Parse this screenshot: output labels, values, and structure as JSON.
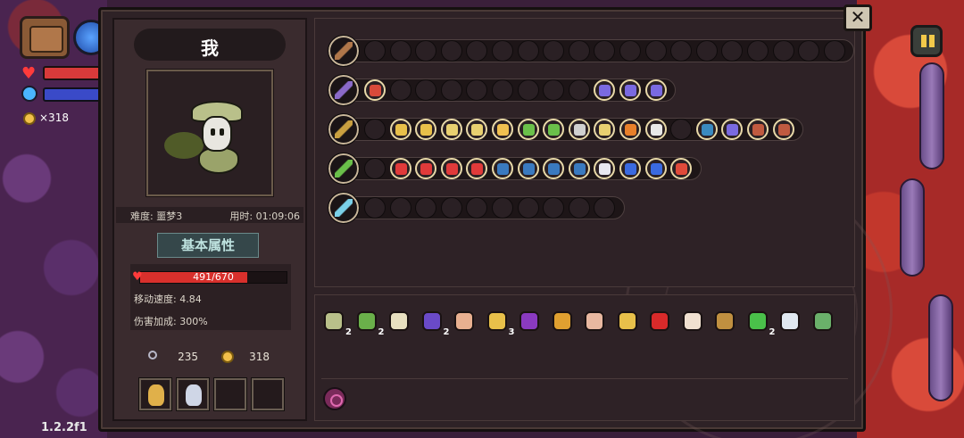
{
  "hud": {
    "coins": "×318",
    "version": "1.2.2f1",
    "close_label": "✕"
  },
  "player": {
    "name": "我",
    "difficulty": "难度: 噩梦3",
    "time": "用时: 01:09:06"
  },
  "attributes": {
    "title": "基本属性",
    "hp_text": "491/670",
    "hp_fraction": 0.733,
    "move_speed": "移动速度: 4.84",
    "damage_bonus": "伤害加成: 300%"
  },
  "resources": {
    "keys": "235",
    "gold": "318"
  },
  "consumable_slots": [
    {
      "icon": "golden-lantern-icon",
      "color": "#e0b04a"
    },
    {
      "icon": "potion-bottle-icon",
      "color": "#cfd6e6"
    },
    {
      "icon": "empty",
      "color": ""
    },
    {
      "icon": "empty",
      "color": ""
    }
  ],
  "weapon_rows": [
    {
      "weapon_icon": "chest-icon",
      "weapon_color": "#b0774a",
      "slots": 19,
      "items": []
    },
    {
      "weapon_icon": "dark-spear-icon",
      "weapon_color": "#8a6ac8",
      "slots": 12,
      "items": [
        {
          "index": 0,
          "icon": "target-icon",
          "color": "#d84a3a"
        },
        {
          "index": 9,
          "icon": "blade-icon",
          "color": "#7a6ae0"
        },
        {
          "index": 10,
          "icon": "blade-icon",
          "color": "#7a6ae0"
        },
        {
          "index": 11,
          "icon": "blade-icon",
          "color": "#7a6ae0"
        }
      ]
    },
    {
      "weapon_icon": "golden-staff-icon",
      "weapon_color": "#c9a040",
      "slots": 17,
      "items": [
        {
          "index": 1,
          "icon": "arrow-icon",
          "color": "#e8c04a"
        },
        {
          "index": 2,
          "icon": "arrow-icon",
          "color": "#e8c04a"
        },
        {
          "index": 3,
          "icon": "scroll-icon",
          "color": "#e8d070"
        },
        {
          "index": 4,
          "icon": "scroll-icon",
          "color": "#e8d070"
        },
        {
          "index": 5,
          "icon": "upgrade-icon",
          "color": "#f0c050"
        },
        {
          "index": 6,
          "icon": "leaf-icon",
          "color": "#6ac04a"
        },
        {
          "index": 7,
          "icon": "leaf-icon",
          "color": "#6ac04a"
        },
        {
          "index": 8,
          "icon": "eye-icon",
          "color": "#d0d0d0"
        },
        {
          "index": 9,
          "icon": "scroll-icon",
          "color": "#e8d070"
        },
        {
          "index": 10,
          "icon": "flame-icon",
          "color": "#e8802a"
        },
        {
          "index": 11,
          "icon": "mouse-icon",
          "color": "#e8e8e8"
        },
        {
          "index": 13,
          "icon": "bow-icon",
          "color": "#3a8ac0"
        },
        {
          "index": 14,
          "icon": "blade-icon",
          "color": "#7a6ae0"
        },
        {
          "index": 15,
          "icon": "heart-organ-icon",
          "color": "#c05a40"
        },
        {
          "index": 16,
          "icon": "heart-organ-icon",
          "color": "#c05a40"
        }
      ]
    },
    {
      "weapon_icon": "green-staff-icon",
      "weapon_color": "#6ac04a",
      "slots": 13,
      "items": [
        {
          "index": 1,
          "icon": "berries-icon",
          "color": "#e03a3a"
        },
        {
          "index": 2,
          "icon": "berries-icon",
          "color": "#e03a3a"
        },
        {
          "index": 3,
          "icon": "berries-icon",
          "color": "#e03a3a"
        },
        {
          "index": 4,
          "icon": "berries-icon",
          "color": "#e03a3a"
        },
        {
          "index": 5,
          "icon": "dagger-icon",
          "color": "#3a7ac0"
        },
        {
          "index": 6,
          "icon": "dagger-icon",
          "color": "#3a7ac0"
        },
        {
          "index": 7,
          "icon": "dagger-icon",
          "color": "#3a7ac0"
        },
        {
          "index": 8,
          "icon": "dagger-icon",
          "color": "#3a7ac0"
        },
        {
          "index": 9,
          "icon": "book-icon",
          "color": "#e8e8f0"
        },
        {
          "index": 10,
          "icon": "vial-icon",
          "color": "#3a6ae0"
        },
        {
          "index": 11,
          "icon": "book-icon",
          "color": "#3a6ae0"
        },
        {
          "index": 12,
          "icon": "crystal-icon",
          "color": "#e04a3a"
        }
      ]
    },
    {
      "weapon_icon": "ice-blade-icon",
      "weapon_color": "#7ad0e8",
      "slots": 10,
      "items": []
    }
  ],
  "inventory": [
    {
      "icon": "straw-hat-icon",
      "color": "#b9c08a",
      "count": "2"
    },
    {
      "icon": "herb-icon",
      "color": "#6ab04a",
      "count": "2"
    },
    {
      "icon": "feather-icon",
      "color": "#e8e0c0",
      "count": ""
    },
    {
      "icon": "wizard-hat-icon",
      "color": "#6a4ac8",
      "count": "2"
    },
    {
      "icon": "ear-icon",
      "color": "#e8b090",
      "count": ""
    },
    {
      "icon": "pickaxe-icon",
      "color": "#e8c04a",
      "count": "3"
    },
    {
      "icon": "cape-icon",
      "color": "#8a3ac0",
      "count": ""
    },
    {
      "icon": "trophy-icon",
      "color": "#e0a030",
      "count": ""
    },
    {
      "icon": "bird-icon",
      "color": "#e8b8a0",
      "count": ""
    },
    {
      "icon": "branch-icon",
      "color": "#e8c04a",
      "count": ""
    },
    {
      "icon": "red-eye-icon",
      "color": "#d82a2a",
      "count": ""
    },
    {
      "icon": "fang-icon",
      "color": "#f0e0d0",
      "count": ""
    },
    {
      "icon": "tablet-icon",
      "color": "#c09040",
      "count": ""
    },
    {
      "icon": "clover-icon",
      "color": "#4ac04a",
      "count": "2"
    },
    {
      "icon": "ghost-icon",
      "color": "#e0e8f0",
      "count": ""
    },
    {
      "icon": "boot-icon",
      "color": "#6ab06a",
      "count": ""
    }
  ],
  "colors": {
    "panel_bg": "#2e2226",
    "accent_gold": "#c9b79a",
    "hp_red": "#d8302c",
    "title_teal": "#bfe3e0"
  }
}
